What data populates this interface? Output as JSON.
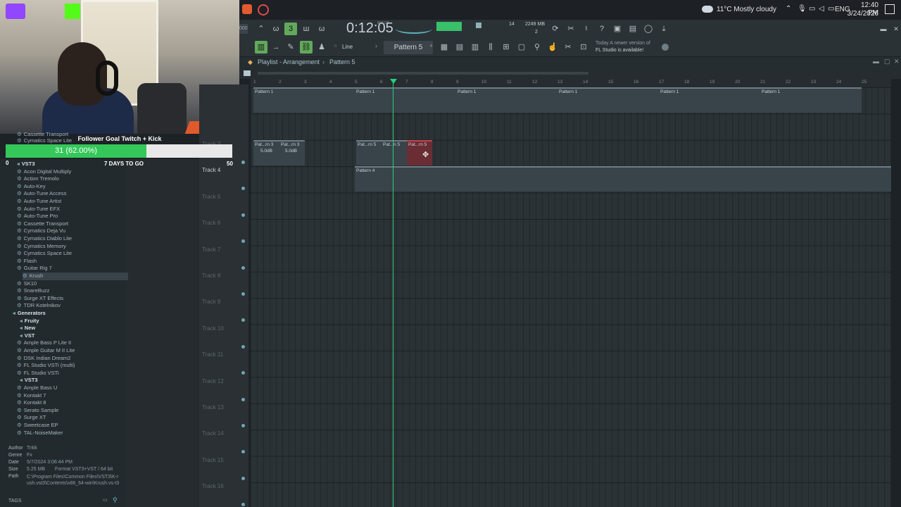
{
  "taskbar": {
    "weather": "11°C  Mostly cloudy",
    "lang": "ENG",
    "time": "12:40 PM",
    "date": "3/24/2026"
  },
  "stream": {
    "goal_title": "Follower Goal Twitch + Kick",
    "goal_text": "31 (62.00%)",
    "goal_progress": 0.62,
    "goal_min": "0",
    "goal_days": "7 DAYS TO GO",
    "goal_max": "50"
  },
  "fl": {
    "time": "0:12:05",
    "time_small": "M:S:CS",
    "cpu": "14",
    "mem": "2249 MB",
    "mem_small": "2",
    "snap": "Line",
    "pattern": "Pattern 5",
    "update_line1": "Today  A newer version of",
    "update_line2": "FL Studio is available!"
  },
  "playlist": {
    "title": "Playlist - Arrangement",
    "sep": "›",
    "pattern": "Pattern 5",
    "ticks": [
      "1",
      "2",
      "3",
      "4",
      "5",
      "6",
      "7",
      "8",
      "9",
      "10",
      "11",
      "12",
      "13",
      "14",
      "15",
      "16",
      "17",
      "18",
      "19",
      "20",
      "21",
      "22",
      "23",
      "24",
      "25"
    ],
    "tracks": [
      "Track 3",
      "Track 4",
      "Track 5",
      "Track 6",
      "Track 7",
      "Track 8",
      "Track 9",
      "Track 10",
      "Track 11",
      "Track 12",
      "Track 13",
      "Track 14",
      "Track 15",
      "Track 16"
    ],
    "clips": {
      "p1": "Pattern 1",
      "pat3a": "Pat...rn 3",
      "pat3b": "Pat...rn 3",
      "db1": "5.0dB",
      "db2": "5.0dB",
      "pat5a": "Pat...rn 5",
      "pat5b": "Pat...n 5",
      "pat5c": "Pat...rn 5",
      "p4": "Pattern 4"
    }
  },
  "browser": {
    "top_items": [
      "Cassette Transport",
      "Cymatics Space Lite"
    ],
    "vst3_label": "VST3",
    "vst3_items": [
      "Acon Digital Multiply",
      "Action Tremolo",
      "Auto-Key",
      "Auto-Tune Access",
      "Auto-Tune Artist",
      "Auto-Tune EFX",
      "Auto-Tune Pro",
      "Cassette Transport",
      "Cymatics Deja Vu",
      "Cymatics Diablo Lite",
      "Cymatics Memory",
      "Cymatics Space Lite",
      "Flash",
      "Guitar Rig 7",
      "Krush",
      "SK10",
      "SnareBuzz",
      "Surge XT Effects",
      "TDR Kotelnikov"
    ],
    "generators": "Generators",
    "fruity": "Fruity",
    "new": "New",
    "vst": "VST",
    "vst_items": [
      "Ample Bass P Lite II",
      "Ample Guitar M II Lite",
      "DSK Indian Dream2",
      "FL Studio VSTi (multi)",
      "FL Studio VSTi"
    ],
    "vst3b": "VST3",
    "vst3b_items": [
      "Ample Bass U",
      "Kontakt 7",
      "Kontakt 8",
      "Serato Sample",
      "Surge XT",
      "Sweetcase EP",
      "TAL-NoiseMaker"
    ],
    "info": {
      "author_k": "Author",
      "author_v": "Tritik",
      "genre_k": "Genre",
      "genre_v": "Fx",
      "date_k": "Date",
      "date_v": "5/7/2024 3:06:44 PM",
      "size_k": "Size",
      "size_v": "5.25 MB",
      "format_v": "Format  VST3+VST / 64 bit",
      "path_k": "Path",
      "path_v": "C:\\Program Files\\Common Files\\VST3\\K-rush.vst3\\Contents\\x86_64-win\\Krush.vs-t3"
    },
    "tags": "TAGS"
  }
}
